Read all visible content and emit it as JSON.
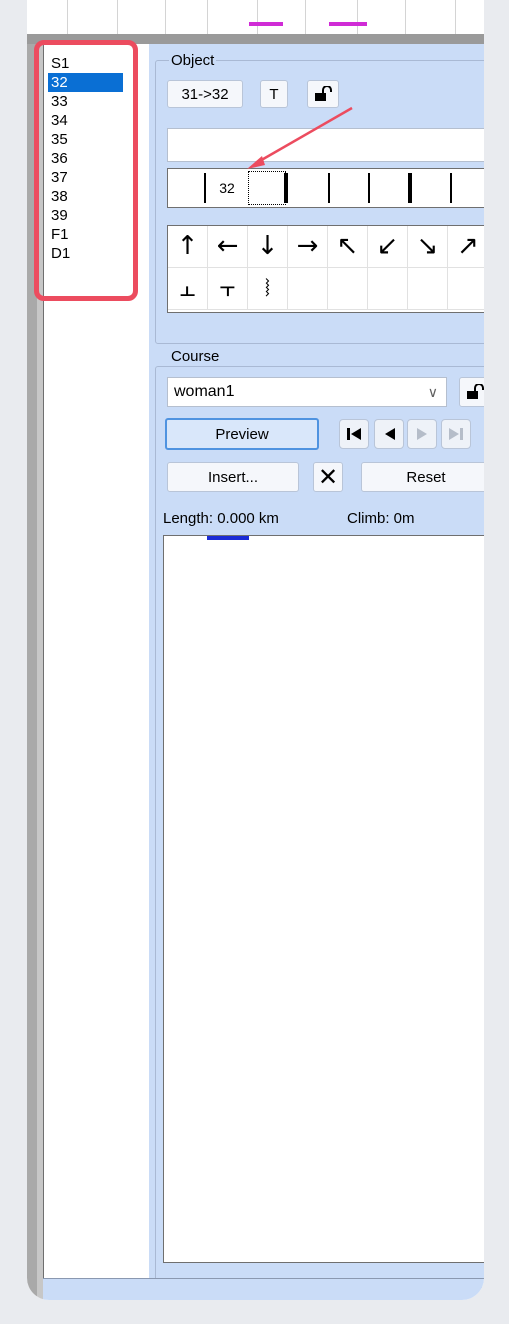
{
  "list": {
    "items": [
      "S1",
      "32",
      "33",
      "34",
      "35",
      "36",
      "37",
      "38",
      "39",
      "F1",
      "D1"
    ],
    "selected_index": 1
  },
  "object": {
    "group_label": "Object",
    "code_button": "31->32",
    "text_button": "T",
    "sequence_number": "32",
    "symbols_row1": [
      "↑",
      "←",
      "↓",
      "→",
      "↖",
      "↙",
      "↘",
      "↗"
    ],
    "symbols_row2": [
      "⫠",
      "⫟",
      "⧘"
    ]
  },
  "course": {
    "group_label": "Course",
    "selected": "woman1",
    "preview_label": "Preview",
    "insert_label": "Insert...",
    "reset_label": "Reset",
    "delete_glyph": "✕",
    "length_text": "Length: 0.000 km",
    "climb_text": "Climb: 0m"
  },
  "colors": {
    "panel": "#cadcf7",
    "selection": "#0a6fd4",
    "highlight": "#ec4c5f",
    "course_mark": "#1a2bd6"
  }
}
